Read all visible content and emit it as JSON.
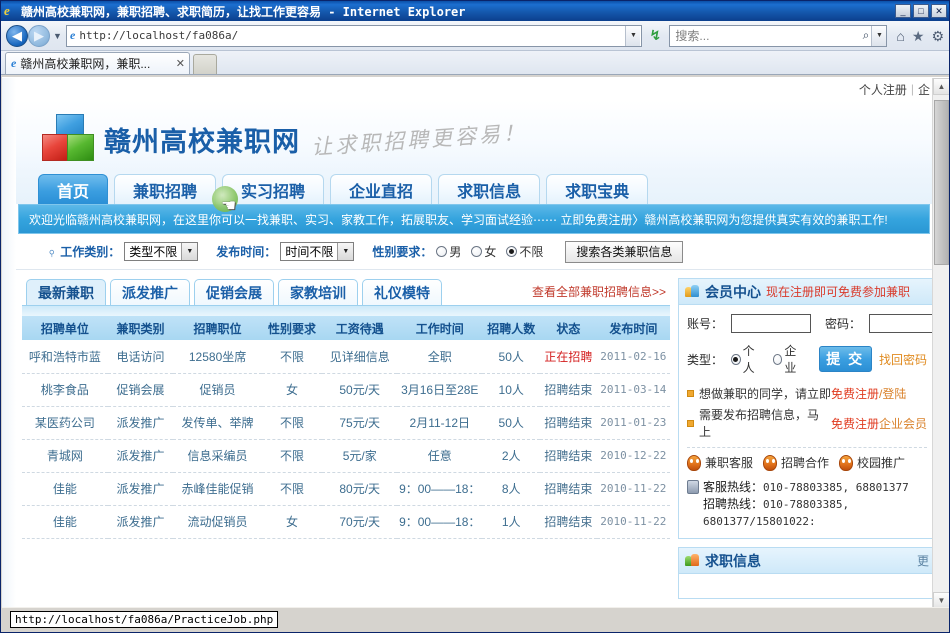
{
  "browser": {
    "window_title": "赣州高校兼职网，兼职招聘、求职简历，让找工作更容易 - Internet Explorer",
    "minimize_label": "_",
    "maximize_label": "□",
    "close_label": "✕",
    "back_label": "◀",
    "forward_label": "▶",
    "history_arrow": "▼",
    "url_scheme": "http://",
    "url_host": "localhost",
    "url_path": "/fa086a/",
    "url_full": "http://localhost/fa086a/",
    "address_dropdown": "▼",
    "refresh_icon": "↯",
    "search_placeholder": "搜索...",
    "search_magnifier": "⌕",
    "search_dropdown": "▼",
    "home_icon": "⌂",
    "favorites_icon": "★",
    "tools_icon": "⚙",
    "tab_label": "赣州高校兼职网，兼职...",
    "tab_close": "✕",
    "status_url": "http://localhost/fa086a/PracticeJob.php"
  },
  "toplinks": {
    "personal_register": "个人注册",
    "separator": "|",
    "company_register": "企"
  },
  "banner": {
    "site_title": "赣州高校兼职网",
    "slogan": "让求职招聘更容易！"
  },
  "mainnav": {
    "items": [
      {
        "label": "首页",
        "active": true
      },
      {
        "label": "兼职招聘",
        "active": false
      },
      {
        "label": "实习招聘",
        "active": false
      },
      {
        "label": "企业直招",
        "active": false
      },
      {
        "label": "求职信息",
        "active": false
      },
      {
        "label": "求职宝典",
        "active": false
      }
    ]
  },
  "welcome": {
    "text": "欢迎光临赣州高校兼职网，在这里你可以一找兼职、实习、家教工作，拓展职友、学习面试经验⋯⋯  立即免费注册〉赣州高校兼职网为您提供真实有效的兼职工作!"
  },
  "filter": {
    "category_label": "工作类别：",
    "category_value": "类型不限",
    "time_label": "发布时间：",
    "time_value": "时间不限",
    "gender_label": "性别要求：",
    "gender_options": [
      {
        "label": "男",
        "selected": false
      },
      {
        "label": "女",
        "selected": false
      },
      {
        "label": "不限",
        "selected": true
      }
    ],
    "search_button": "搜索各类兼职信息"
  },
  "jobpanel": {
    "tabs": [
      {
        "label": "最新兼职",
        "active": true
      },
      {
        "label": "派发推广",
        "active": false
      },
      {
        "label": "促销会展",
        "active": false
      },
      {
        "label": "家教培训",
        "active": false
      },
      {
        "label": "礼仪模特",
        "active": false
      }
    ],
    "view_all": "查看全部兼职招聘信息>>",
    "columns": [
      "招聘单位",
      "兼职类别",
      "招聘职位",
      "性别要求",
      "工资待遇",
      "工作时间",
      "招聘人数",
      "状态",
      "发布时间"
    ],
    "rows": [
      {
        "unit": "呼和浩特市蓝",
        "category": "电话访问",
        "position": "12580坐席",
        "gender": "不限",
        "salary": "见详细信息",
        "worktime": "全职",
        "count": "50人",
        "status": "正在招聘",
        "status_open": true,
        "date": "2011-02-16"
      },
      {
        "unit": "桃李食品",
        "category": "促销会展",
        "position": "促销员",
        "gender": "女",
        "salary": "50元/天",
        "worktime": "3月16日至28E",
        "count": "10人",
        "status": "招聘结束",
        "status_open": false,
        "date": "2011-03-14"
      },
      {
        "unit": "某医药公司",
        "category": "派发推广",
        "position": "发传单、举牌",
        "gender": "不限",
        "salary": "75元/天",
        "worktime": "2月11-12日",
        "count": "50人",
        "status": "招聘结束",
        "status_open": false,
        "date": "2011-01-23"
      },
      {
        "unit": "青城网",
        "category": "派发推广",
        "position": "信息采编员",
        "gender": "不限",
        "salary": "5元/家",
        "worktime": "任意",
        "count": "2人",
        "status": "招聘结束",
        "status_open": false,
        "date": "2010-12-22"
      },
      {
        "unit": "佳能",
        "category": "派发推广",
        "position": "赤峰佳能促销",
        "gender": "不限",
        "salary": "80元/天",
        "worktime": "9：00——18：",
        "count": "8人",
        "status": "招聘结束",
        "status_open": false,
        "date": "2010-11-22"
      },
      {
        "unit": "佳能",
        "category": "派发推广",
        "position": "流动促销员",
        "gender": "女",
        "salary": "70元/天",
        "worktime": "9：00——18：",
        "count": "1人",
        "status": "招聘结束",
        "status_open": false,
        "date": "2010-11-22"
      }
    ]
  },
  "member": {
    "title": "会员中心",
    "note": "现在注册即可免费参加兼职",
    "account_label": "账号：",
    "account_value": "",
    "password_label": "密码：",
    "password_value": "",
    "type_label": "类型：",
    "type_options": [
      {
        "label": "个人",
        "selected": true
      },
      {
        "label": "企业",
        "selected": false
      }
    ],
    "submit_label": "提 交",
    "find_password": "找回密码",
    "tip1_prefix": "想做兼职的同学，请立即",
    "tip1_link1": "免费注册",
    "tip1_slash": "/",
    "tip1_link2": "登陆",
    "tip2_prefix": "需要发布招聘信息，马上",
    "tip2_link1": "免费注册",
    "tip2_link2": "企业会员",
    "qq_items": [
      "兼职客服",
      "招聘合作",
      "校园推广"
    ],
    "service_hotline_label": "客服热线：",
    "service_hotline_value": "010-78803385, 68801377",
    "recruit_hotline_label": "招聘热线：",
    "recruit_hotline_value": "010-78803385, 6801377/15801022:"
  },
  "jobseek": {
    "title": "求职信息",
    "more": "更"
  },
  "scroll": {
    "up_arrow": "▲",
    "down_arrow": "▼"
  },
  "colors": {
    "brand_blue": "#1a5fa8",
    "accent_cyan": "#35a4de",
    "status_open": "#d42020",
    "link_red": "#c0392b"
  }
}
